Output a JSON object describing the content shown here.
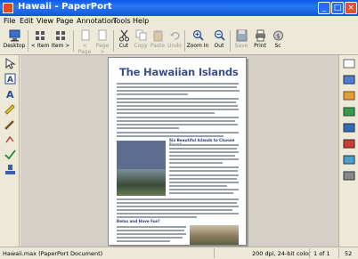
{
  "window": {
    "title": "Hawaii - PaperPort",
    "controls": {
      "minimize": "_",
      "maximize": "□",
      "close": "×"
    }
  },
  "menu": [
    "File",
    "Edit",
    "View",
    "Page",
    "Annotation",
    "Tools",
    "Help"
  ],
  "toolbar": {
    "desktop": "Desktop",
    "item_prev": "< Item",
    "item_next": "Item >",
    "page_prev": "< Page",
    "page_next": "Page >",
    "cut": "Cut",
    "copy": "Copy",
    "paste": "Paste",
    "undo": "Undo",
    "zoom_in": "Zoom In",
    "zoom_out": "Out",
    "save": "Save",
    "print": "Print",
    "scan": "Sc"
  },
  "document": {
    "heading": "The Hawaiian Islands",
    "subheading_1": "Six Beautiful Islands to Choose From!",
    "subheading_2": "Relax and Have Fun!"
  },
  "status": {
    "file": "Hawaii.max (PaperPort Document)",
    "resolution": "200 dpi, 24-bit color",
    "page": "1 of 1",
    "extra": "52"
  }
}
